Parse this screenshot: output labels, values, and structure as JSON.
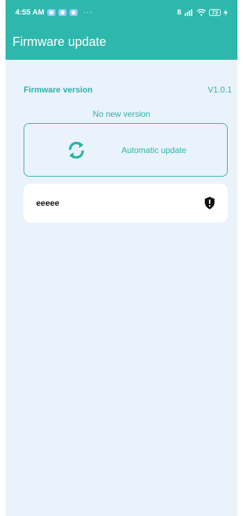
{
  "status_bar": {
    "time": "4:55 AM",
    "dots": "···",
    "signal_text": "8",
    "battery": "73"
  },
  "header": {
    "title": "Firmware update"
  },
  "firmware": {
    "label": "Firmware version",
    "version": "V1.0.1",
    "status": "No new version"
  },
  "update_button": {
    "label": "Automatic update",
    "icon": "sync-icon"
  },
  "device": {
    "name": "eeeee",
    "icon": "shield-alert-icon"
  },
  "colors": {
    "accent": "#2eb8ad",
    "background": "#eaf2fb",
    "card": "#ffffff"
  }
}
